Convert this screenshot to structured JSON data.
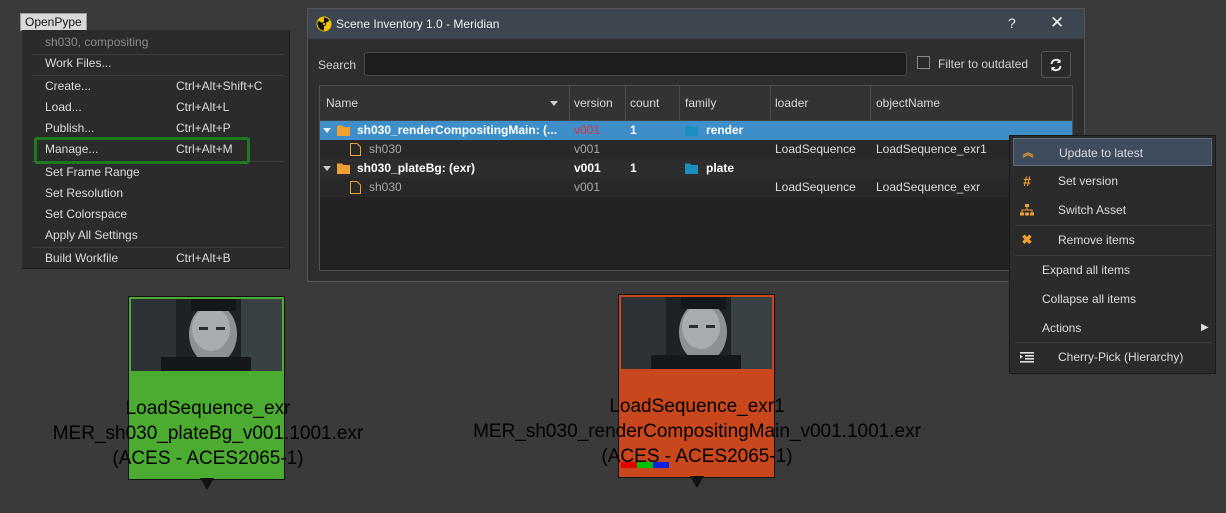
{
  "openpype_menu": {
    "title": "OpenPype",
    "context": "sh030, compositing",
    "items": [
      {
        "label": "Work Files...",
        "shortcut": ""
      },
      {
        "label": "Create...",
        "shortcut": "Ctrl+Alt+Shift+C"
      },
      {
        "label": "Load...",
        "shortcut": "Ctrl+Alt+L"
      },
      {
        "label": "Publish...",
        "shortcut": "Ctrl+Alt+P"
      },
      {
        "label": "Manage...",
        "shortcut": "Ctrl+Alt+M"
      },
      {
        "label": "Set Frame Range",
        "shortcut": ""
      },
      {
        "label": "Set Resolution",
        "shortcut": ""
      },
      {
        "label": "Set Colorspace",
        "shortcut": ""
      },
      {
        "label": "Apply All Settings",
        "shortcut": ""
      },
      {
        "label": "Build Workfile",
        "shortcut": "Ctrl+Alt+B"
      }
    ]
  },
  "scene_inventory": {
    "title": "Scene Inventory 1.0 - Meridian",
    "help": "?",
    "close": "✕",
    "search_label": "Search",
    "search_value": "",
    "filter_label": "Filter to outdated",
    "columns": [
      "Name",
      "version",
      "count",
      "family",
      "loader",
      "objectName"
    ],
    "rows": [
      {
        "name": "sh030_renderCompositingMain: (...",
        "version": "v001",
        "count": "1",
        "family": "render",
        "loader": "",
        "object": "",
        "group": true,
        "outdated": true
      },
      {
        "name": "sh030",
        "version": "v001",
        "count": "",
        "family": "",
        "loader": "LoadSequence",
        "object": "LoadSequence_exr1",
        "group": false
      },
      {
        "name": "sh030_plateBg: (exr)",
        "version": "v001",
        "count": "1",
        "family": "plate",
        "loader": "",
        "object": "",
        "group": true,
        "outdated": false
      },
      {
        "name": "sh030",
        "version": "v001",
        "count": "",
        "family": "",
        "loader": "LoadSequence",
        "object": "LoadSequence_exr",
        "group": false
      }
    ]
  },
  "context_menu": {
    "items": [
      {
        "label": "Update to latest",
        "icon": "double-chevron-up-icon"
      },
      {
        "label": "Set version",
        "icon": "hash-icon"
      },
      {
        "label": "Switch Asset",
        "icon": "sitemap-icon"
      },
      {
        "label": "Remove items",
        "icon": "x-icon"
      },
      {
        "label": "Expand all items",
        "icon": ""
      },
      {
        "label": "Collapse all items",
        "icon": ""
      },
      {
        "label": "Actions",
        "icon": "chevron-right-icon"
      },
      {
        "label": "Cherry-Pick (Hierarchy)",
        "icon": "list-indent-icon"
      }
    ]
  },
  "nodes": [
    {
      "line1": "LoadSequence_exr",
      "line2": "MER_sh030_plateBg_v001.1001.exr",
      "line3": "(ACES - ACES2065-1)",
      "color": "#4cab31"
    },
    {
      "line1": "LoadSequence_exr1",
      "line2": "MER_sh030_renderCompositingMain_v001.1001.exr",
      "line3": "(ACES - ACES2065-1)",
      "color": "#c8471c"
    }
  ],
  "colors": {
    "accent": "#3d8ec9",
    "highlight_green": "#1e7a1e",
    "folder": "#f0a030",
    "family_icon": "#1a8fc0",
    "outdated": "#e23030"
  }
}
